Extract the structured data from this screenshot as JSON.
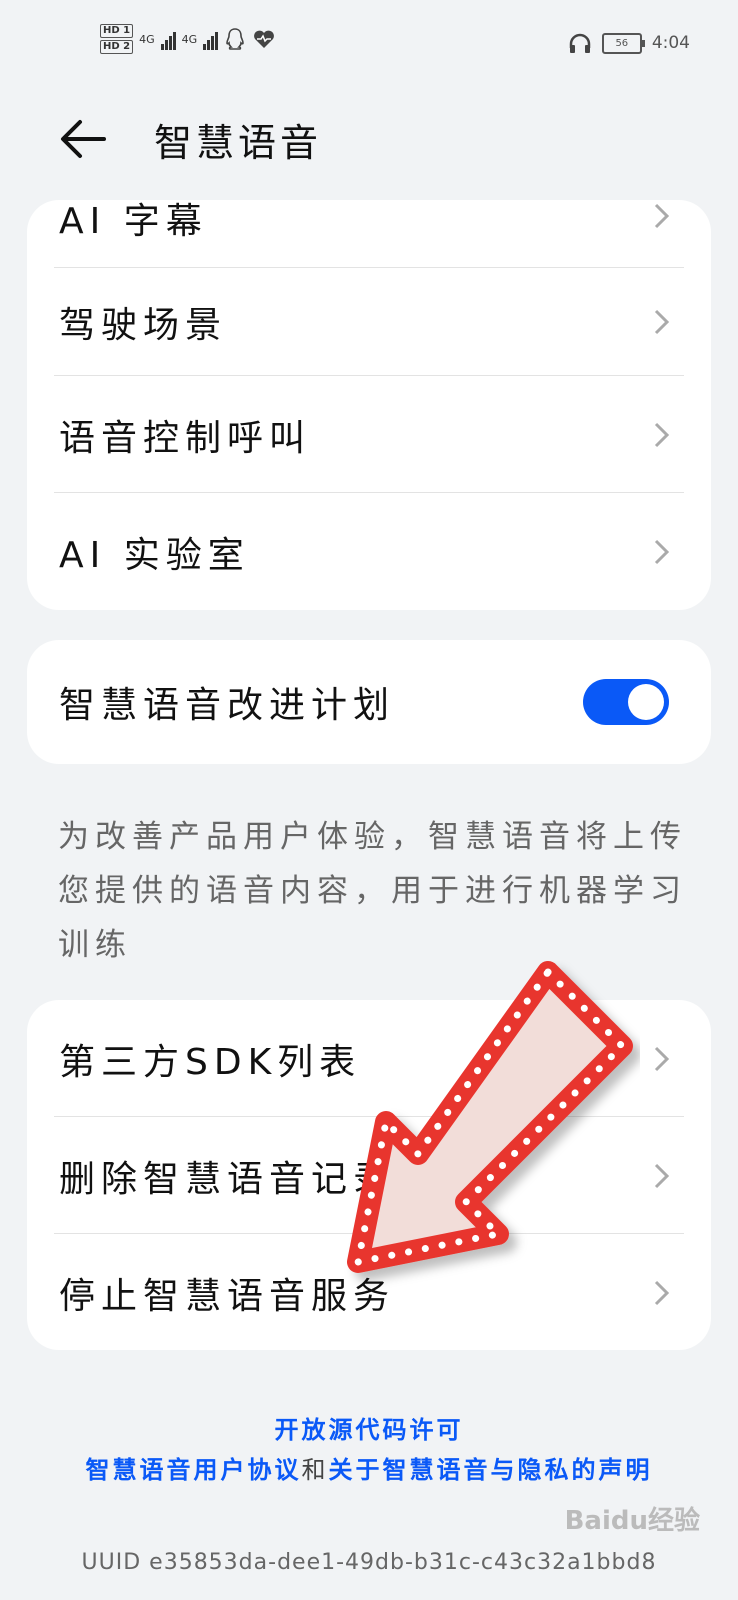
{
  "status_bar": {
    "sim1": "HD 1",
    "sim2": "HD 2",
    "network1": "4G",
    "network2": "4G",
    "battery": "56",
    "time": "4:04"
  },
  "header": {
    "title": "智慧语音"
  },
  "settings_group1": [
    {
      "label": "AI 字幕"
    },
    {
      "label": "驾驶场景"
    },
    {
      "label": "语音控制呼叫"
    },
    {
      "label": "AI 实验室"
    }
  ],
  "improvement": {
    "label": "智慧语音改进计划",
    "enabled": true,
    "description": "为改善产品用户体验，智慧语音将上传您提供的语音内容，用于进行机器学习训练"
  },
  "settings_group2": [
    {
      "label": "第三方SDK列表"
    },
    {
      "label": "删除智慧语音记录"
    },
    {
      "label": "停止智慧语音服务"
    }
  ],
  "footer": {
    "open_source": "开放源代码许可",
    "agreement_a": "智慧语音用户协议",
    "conjunction": "和",
    "agreement_b": "关于智慧语音与隐私的声明",
    "uuid": "UUID e35853da-dee1-49db-b31c-c43c32a1bbd8"
  },
  "watermark": "Baidu经验",
  "colors": {
    "accent": "#0a59f7",
    "background": "#f1f3f5",
    "arrow": "#e8352e"
  },
  "icons": [
    "back-arrow-icon",
    "chevron-right-icon",
    "headphones-icon",
    "battery-icon",
    "signal-icon",
    "qq-icon",
    "heart-icon"
  ]
}
